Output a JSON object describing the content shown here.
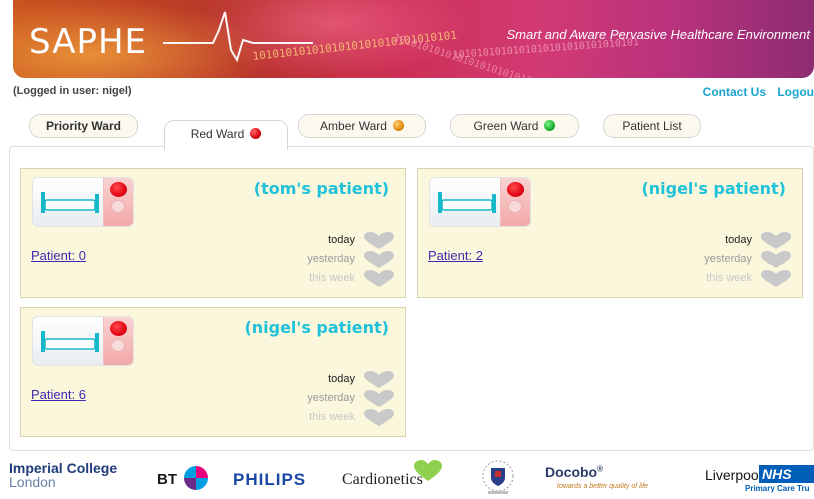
{
  "header": {
    "logo_text": "SAPHE",
    "tagline": "Smart and Aware Pervasive Healthcare Environment",
    "binary_text": "1010101010101010101010101010101"
  },
  "userbar": {
    "logged_in": "(Logged in user: nigel)",
    "contact_label": "Contact Us",
    "logout_label": "Logou"
  },
  "tabs": [
    {
      "label": "Priority Ward",
      "indicator": null
    },
    {
      "label": "Red Ward",
      "indicator": "red"
    },
    {
      "label": "Amber Ward",
      "indicator": "amber"
    },
    {
      "label": "Green Ward",
      "indicator": "green"
    },
    {
      "label": "Patient List",
      "indicator": null
    }
  ],
  "active_tab": "Red Ward",
  "patients": [
    {
      "owner": "(tom's patient)",
      "link": "Patient: 0",
      "history": [
        "today",
        "yesterday",
        "this week"
      ],
      "status": "red"
    },
    {
      "owner": "(nigel's patient)",
      "link": "Patient: 2",
      "history": [
        "today",
        "yesterday",
        "this week"
      ],
      "status": "red"
    },
    {
      "owner": "(nigel's patient)",
      "link": "Patient: 6",
      "history": [
        "today",
        "yesterday",
        "this week"
      ],
      "status": "red"
    }
  ],
  "footer": {
    "imperial_line1": "Imperial College",
    "imperial_line2": "London",
    "bt": "BT",
    "philips": "PHILIPS",
    "cardionetics": "Cardionetics",
    "docobo": "Docobo",
    "docobo_tagline": "towards a better quality of life",
    "liverpool": "Liverpool",
    "nhs": "NHS",
    "primary_care": "Primary Care Tru"
  },
  "colors": {
    "accent_link": "#19a3cf",
    "owner_text": "#1fc2d8",
    "card_bg": "#fbf7dc",
    "red_status": "#e00010",
    "amber_status": "#e08a10",
    "green_status": "#18b030"
  }
}
